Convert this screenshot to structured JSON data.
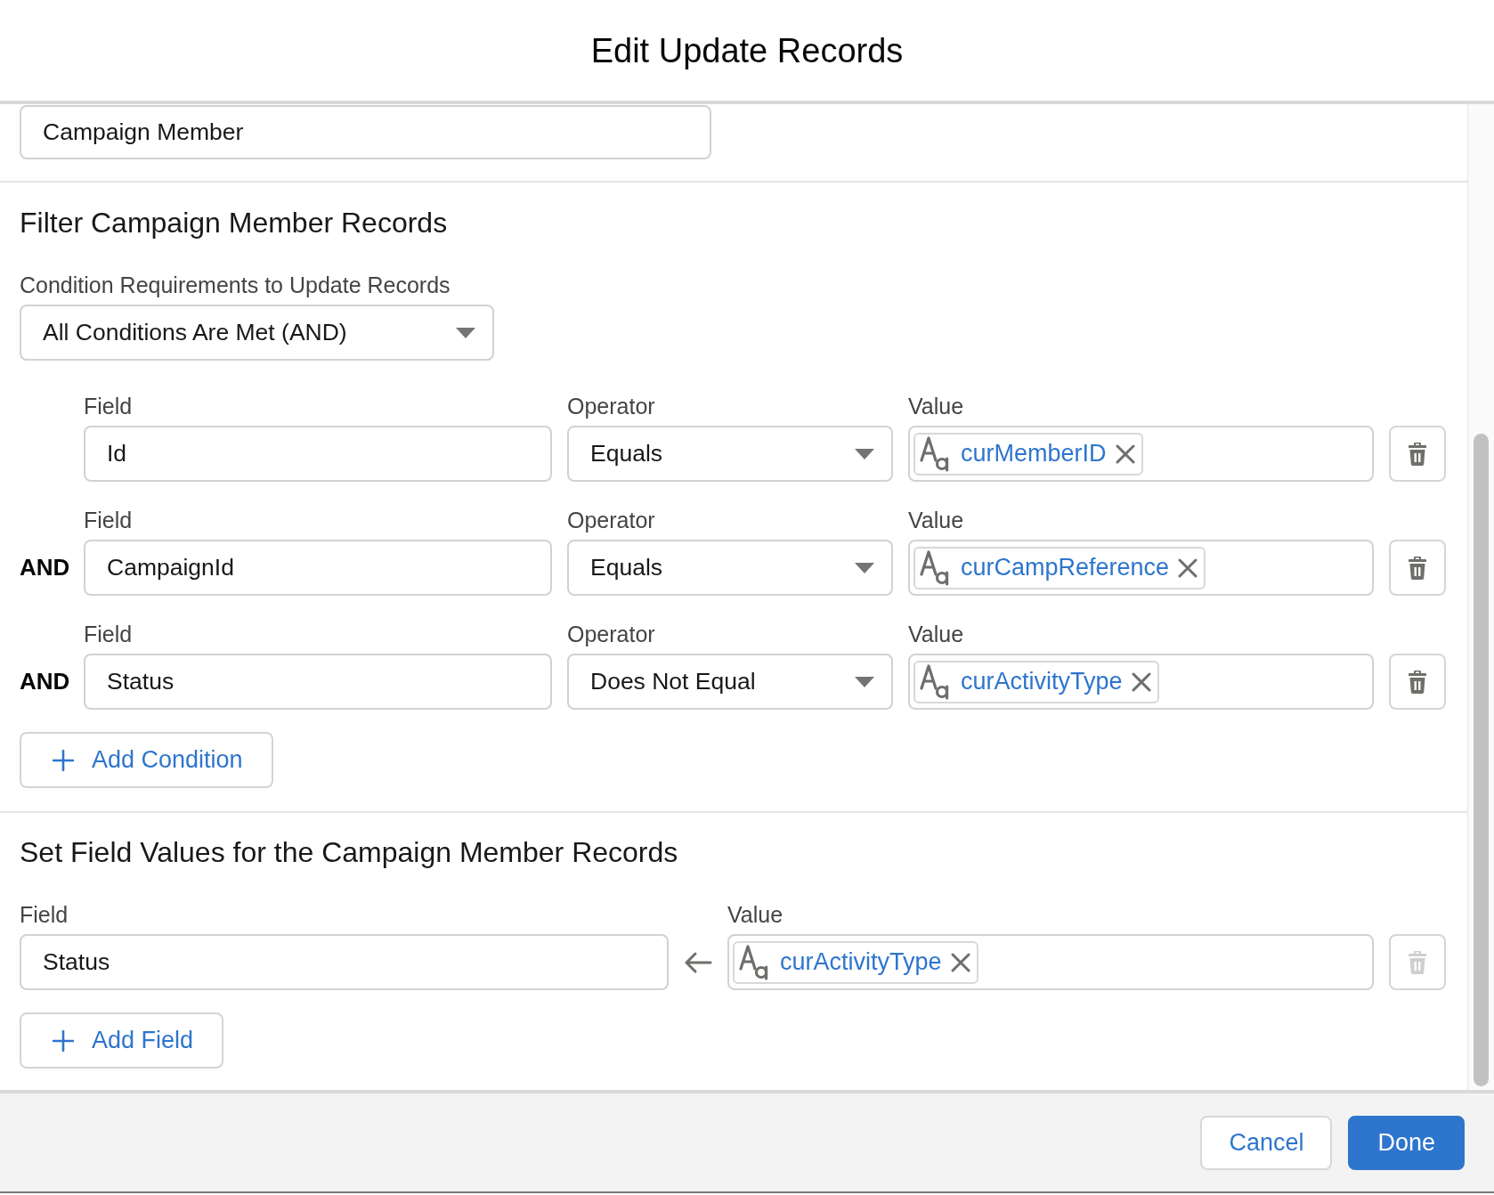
{
  "modal": {
    "title": "Edit Update Records"
  },
  "object_field": {
    "value": "Campaign Member"
  },
  "filter": {
    "heading": "Filter Campaign Member Records",
    "requirement_label": "Condition Requirements to Update Records",
    "requirement": "All Conditions Are Met (AND)",
    "conditions": [
      {
        "field_label": "Field",
        "field": "Id",
        "operator_label": "Operator",
        "operator": "Equals",
        "value_label": "Value",
        "value": "curMemberID",
        "delete_disabled": false
      },
      {
        "connector": "AND",
        "field_label": "Field",
        "field": "CampaignId",
        "operator_label": "Operator",
        "operator": "Equals",
        "value_label": "Value",
        "value": "curCampReference",
        "delete_disabled": false
      },
      {
        "connector": "AND",
        "field_label": "Field",
        "field": "Status",
        "operator_label": "Operator",
        "operator": "Does Not Equal",
        "value_label": "Value",
        "value": "curActivityType",
        "delete_disabled": false
      }
    ],
    "add_button": "Add Condition"
  },
  "assignments": {
    "heading": "Set Field Values for the Campaign Member Records",
    "rows": [
      {
        "field_label": "Field",
        "field": "Status",
        "value_label": "Value",
        "value": "curActivityType",
        "delete_disabled": true
      }
    ],
    "add_button": "Add Field"
  },
  "footer": {
    "buttons": [
      {
        "label": "Cancel",
        "kind": "neutral"
      },
      {
        "label": "Done",
        "kind": "brand"
      }
    ]
  }
}
